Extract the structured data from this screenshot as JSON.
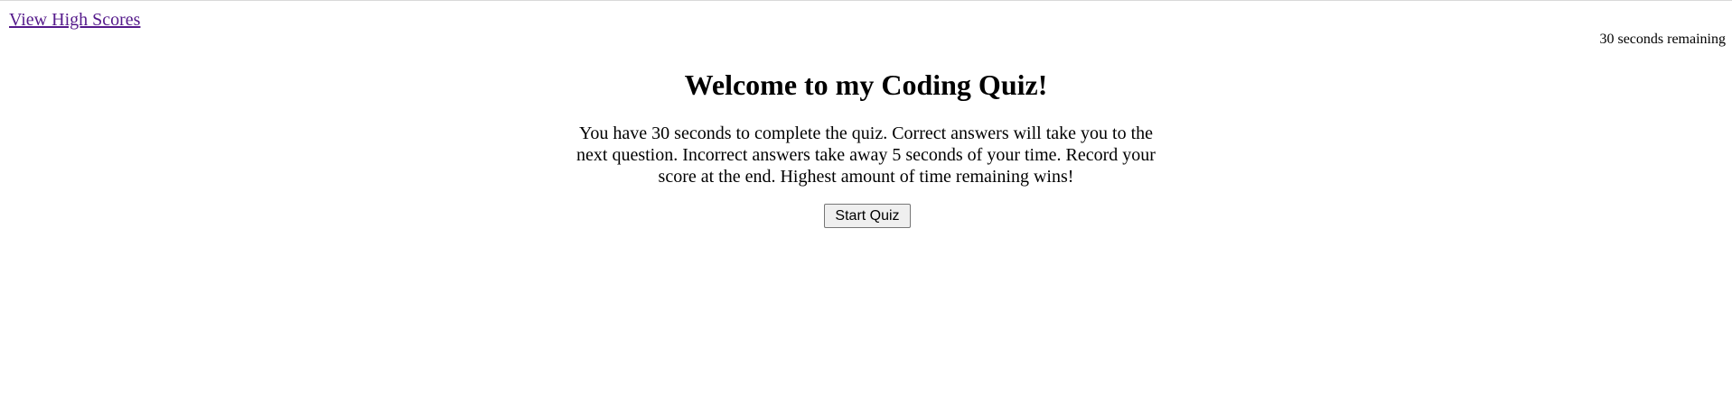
{
  "nav": {
    "high_scores_link": "View High Scores"
  },
  "timer": {
    "text": "30 seconds remaining"
  },
  "intro": {
    "title": "Welcome to my Coding Quiz!",
    "instructions": "You have 30 seconds to complete the quiz. Correct answers will take you to the next question. Incorrect answers take away 5 seconds of your time. Record your score at the end. Highest amount of time remaining wins!",
    "start_button": "Start Quiz"
  },
  "colors": {
    "link_visited": "#551a8b",
    "button_bg": "#efefef",
    "button_border": "#767676"
  }
}
